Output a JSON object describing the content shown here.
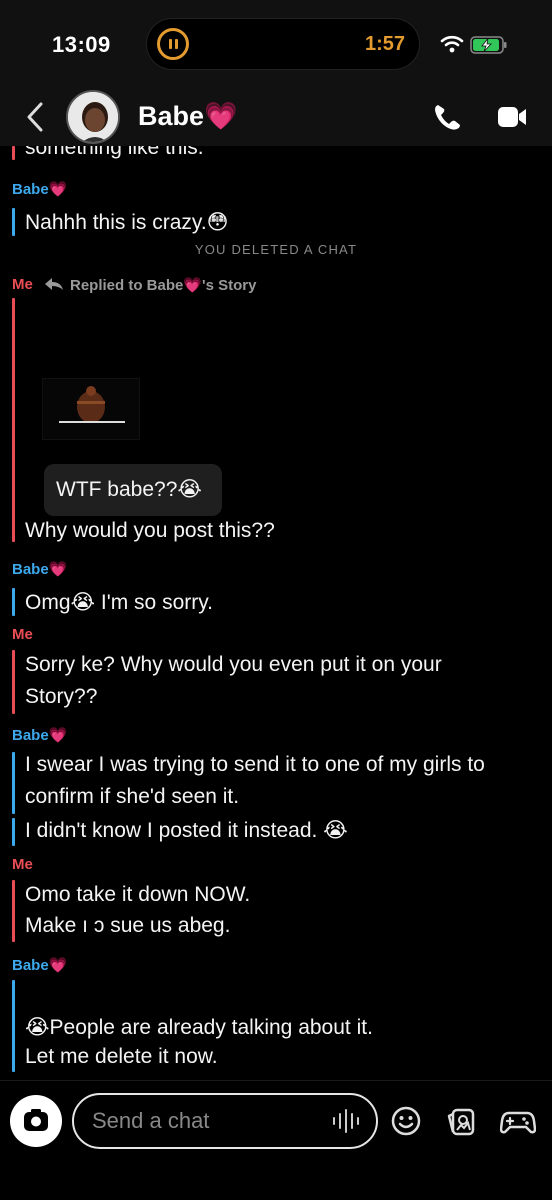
{
  "status_bar": {
    "time": "13:09",
    "island_timer": "1:57",
    "accent_color": "#e39b2f"
  },
  "header": {
    "contact_name": "Babe💗"
  },
  "chat": {
    "partial_top": "something like this.",
    "sender_babe": "Babe💗",
    "sender_me": "Me",
    "system_notice": "YOU DELETED A CHAT",
    "replied_to": "Replied to Babe💗's Story",
    "story_caption": "WTF babe??😭",
    "messages": [
      "Nahhh this is crazy.😳",
      "Why would you post this??",
      "Omg😭 I'm so sorry.",
      "Sorry ke? Why would you even put it on your",
      "Story??",
      "I swear I was trying to send it to one of my girls to",
      "confirm if she'd seen it.",
      "I didn't know I posted it instead. 😭",
      "Omo take it down NOW.",
      "Make ı ɔ sue us abeg.",
      "😭People are already talking about it.",
      "Let me delete it now."
    ],
    "colors": {
      "babe": "#3da9ec",
      "me": "#e84d54"
    }
  },
  "composer": {
    "placeholder": "Send a chat"
  },
  "icons": [
    "pause-icon",
    "wifi-icon",
    "battery-charging-icon",
    "back-icon",
    "phone-icon",
    "video-icon",
    "reply-icon",
    "camera-icon",
    "voice-icon",
    "emoji-icon",
    "sticker-icon",
    "game-icon"
  ]
}
